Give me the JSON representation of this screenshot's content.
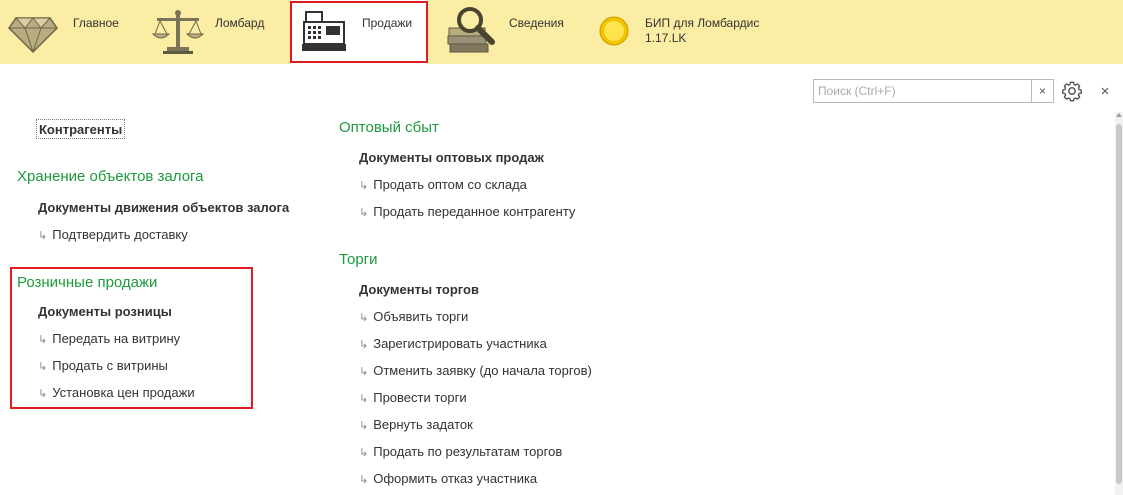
{
  "sections": {
    "main": "Главное",
    "pawnshop": "Ломбард",
    "sales": "Продажи",
    "info": "Сведения",
    "bip_line1": "БИП для Ломбардис",
    "bip_line2": "1.17.LK"
  },
  "search": {
    "placeholder": "Поиск (Ctrl+F)",
    "value": ""
  },
  "icons": {
    "clear": "×",
    "close": "×",
    "arrow": "↳"
  },
  "left": {
    "counterparties": "Контрагенты",
    "storage": {
      "title": "Хранение объектов залога",
      "docs": "Документы движения объектов залога",
      "items": [
        "Подтвердить доставку"
      ]
    },
    "retail": {
      "title": "Розничные продажи",
      "docs": "Документы розницы",
      "items": [
        "Передать на витрину",
        "Продать с витрины",
        "Установка цен продажи"
      ]
    }
  },
  "right": {
    "wholesale": {
      "title": "Оптовый сбыт",
      "docs": "Документы оптовых продаж",
      "items": [
        "Продать оптом со склада",
        "Продать переданное контрагенту"
      ]
    },
    "auctions": {
      "title": "Торги",
      "docs": "Документы торгов",
      "items": [
        "Объявить торги",
        "Зарегистрировать участника",
        "Отменить заявку (до начала торгов)",
        "Провести торги",
        "Вернуть задаток",
        "Продать по результатам торгов",
        "Оформить отказ участника"
      ]
    }
  },
  "colors": {
    "topbar": "#fbeda3",
    "group_title": "#1d9a3c",
    "highlight": "#e21b23"
  }
}
